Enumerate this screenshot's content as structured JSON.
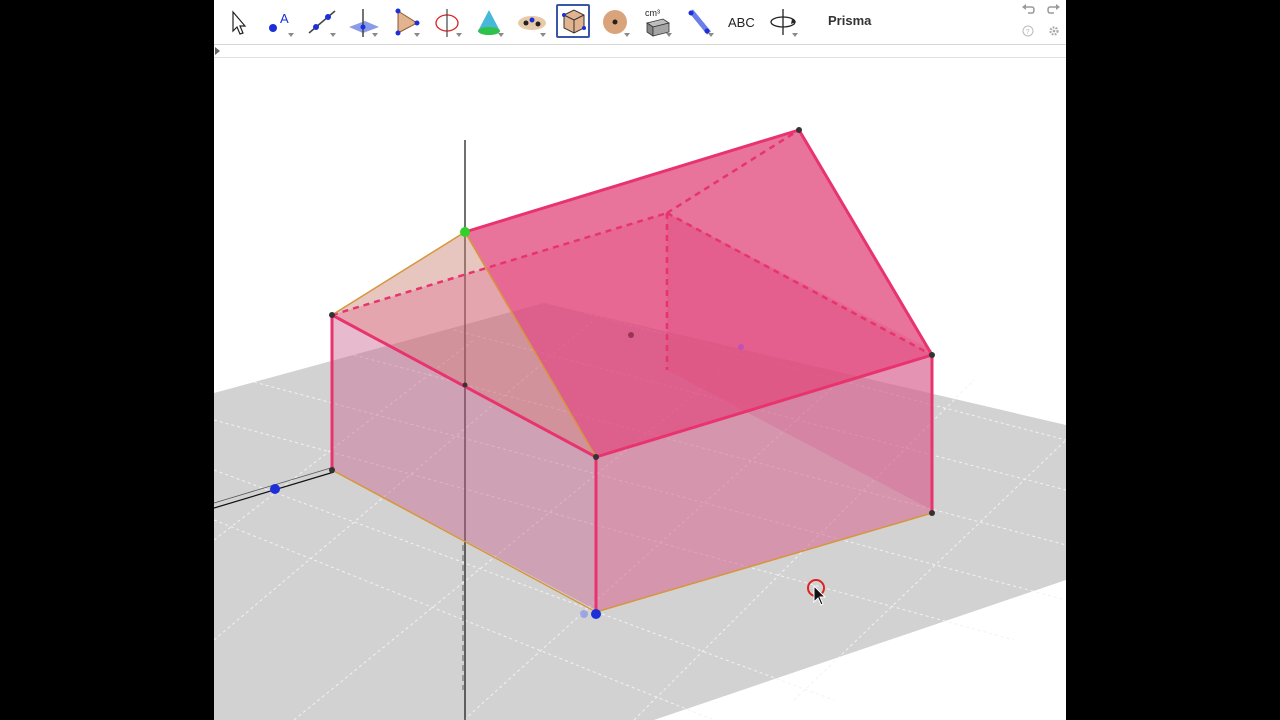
{
  "toolbar": {
    "tools": [
      {
        "id": "move",
        "icon": "pointer-arrow-icon"
      },
      {
        "id": "point",
        "icon": "point-label-icon",
        "text": "A"
      },
      {
        "id": "line",
        "icon": "line-through-points-icon"
      },
      {
        "id": "perpendicular",
        "icon": "perpendicular-line-icon"
      },
      {
        "id": "polygon",
        "icon": "polygon-icon"
      },
      {
        "id": "circle",
        "icon": "circle-axis-icon"
      },
      {
        "id": "intersect-surfaces",
        "icon": "cone-icon"
      },
      {
        "id": "plane",
        "icon": "plane-points-icon"
      },
      {
        "id": "prism",
        "icon": "prism-icon"
      },
      {
        "id": "sphere",
        "icon": "sphere-icon"
      },
      {
        "id": "volume",
        "icon": "volume-icon",
        "text": "cm³"
      },
      {
        "id": "reflect",
        "icon": "reflect-plane-icon"
      },
      {
        "id": "text",
        "icon": "text-icon",
        "text": "ABC"
      },
      {
        "id": "rotate-view",
        "icon": "rotate-view-icon"
      }
    ],
    "selected_tool": "prism",
    "selected_tool_name": "Prisma"
  },
  "colors": {
    "prism_fill": "#e0457a",
    "prism_edge": "#e8336e",
    "base_edge": "#d7963c",
    "grid_plane": "#cfcfcf",
    "point_blue": "#1c2fd8",
    "point_green": "#31d12a",
    "toolbar_selected": "#3a56a8"
  }
}
